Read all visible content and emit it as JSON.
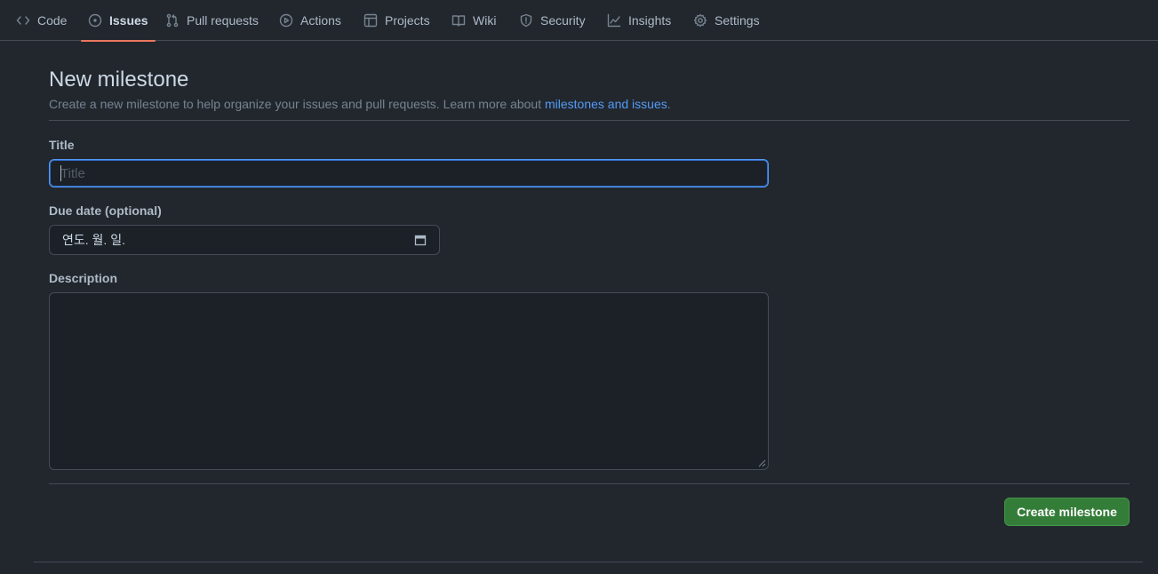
{
  "nav": {
    "items": [
      {
        "label": "Code",
        "icon": "code-icon",
        "active": false
      },
      {
        "label": "Issues",
        "icon": "issue-opened-icon",
        "active": true
      },
      {
        "label": "Pull requests",
        "icon": "git-pull-request-icon",
        "active": false
      },
      {
        "label": "Actions",
        "icon": "play-icon",
        "active": false
      },
      {
        "label": "Projects",
        "icon": "table-icon",
        "active": false
      },
      {
        "label": "Wiki",
        "icon": "book-icon",
        "active": false
      },
      {
        "label": "Security",
        "icon": "shield-icon",
        "active": false
      },
      {
        "label": "Insights",
        "icon": "graph-icon",
        "active": false
      },
      {
        "label": "Settings",
        "icon": "gear-icon",
        "active": false
      }
    ]
  },
  "header": {
    "title": "New milestone",
    "subtitle": "Create a new milestone to help organize your issues and pull requests. Learn more about ",
    "link_text": "milestones and issues",
    "subtitle_end": "."
  },
  "form": {
    "title_label": "Title",
    "title_placeholder": "Title",
    "title_value": "",
    "due_label": "Due date (optional)",
    "due_value": "연도. 월. 일.",
    "description_label": "Description",
    "description_value": ""
  },
  "actions": {
    "create_label": "Create milestone"
  },
  "colors": {
    "background": "#22272e",
    "active_underline": "#ec775c",
    "link": "#539bf5",
    "primary_button": "#347d39"
  }
}
